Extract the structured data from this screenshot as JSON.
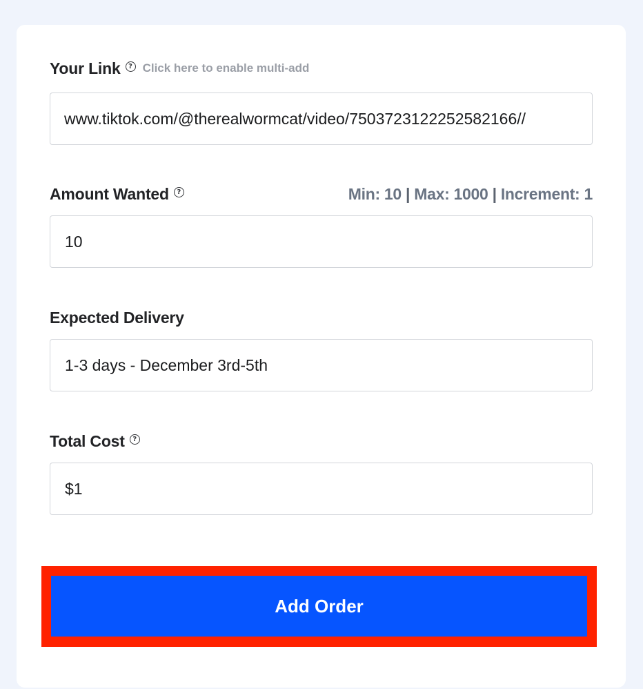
{
  "form": {
    "link": {
      "label": "Your Link",
      "help_icon": "question-circle-icon",
      "multi_add_text": "Click here to enable multi-add",
      "value": "//www.tiktok.com/@therealwormcat/video/7503723122252582166"
    },
    "amount": {
      "label": "Amount Wanted",
      "help_icon": "question-circle-icon",
      "min_text": "Min: 10",
      "max_text": "Max: 1000",
      "increment_text": "Increment: 1",
      "separator": "|",
      "value": "10"
    },
    "delivery": {
      "label": "Expected Delivery",
      "value": "1-3 days - December 3rd-5th"
    },
    "total": {
      "label": "Total Cost",
      "help_icon": "question-circle-icon",
      "value": "$1"
    },
    "submit_label": "Add Order"
  },
  "colors": {
    "page_background": "#f0f4fc",
    "button": "#0655ff",
    "highlight": "#ff2200",
    "limits_text": "#6a7483"
  }
}
